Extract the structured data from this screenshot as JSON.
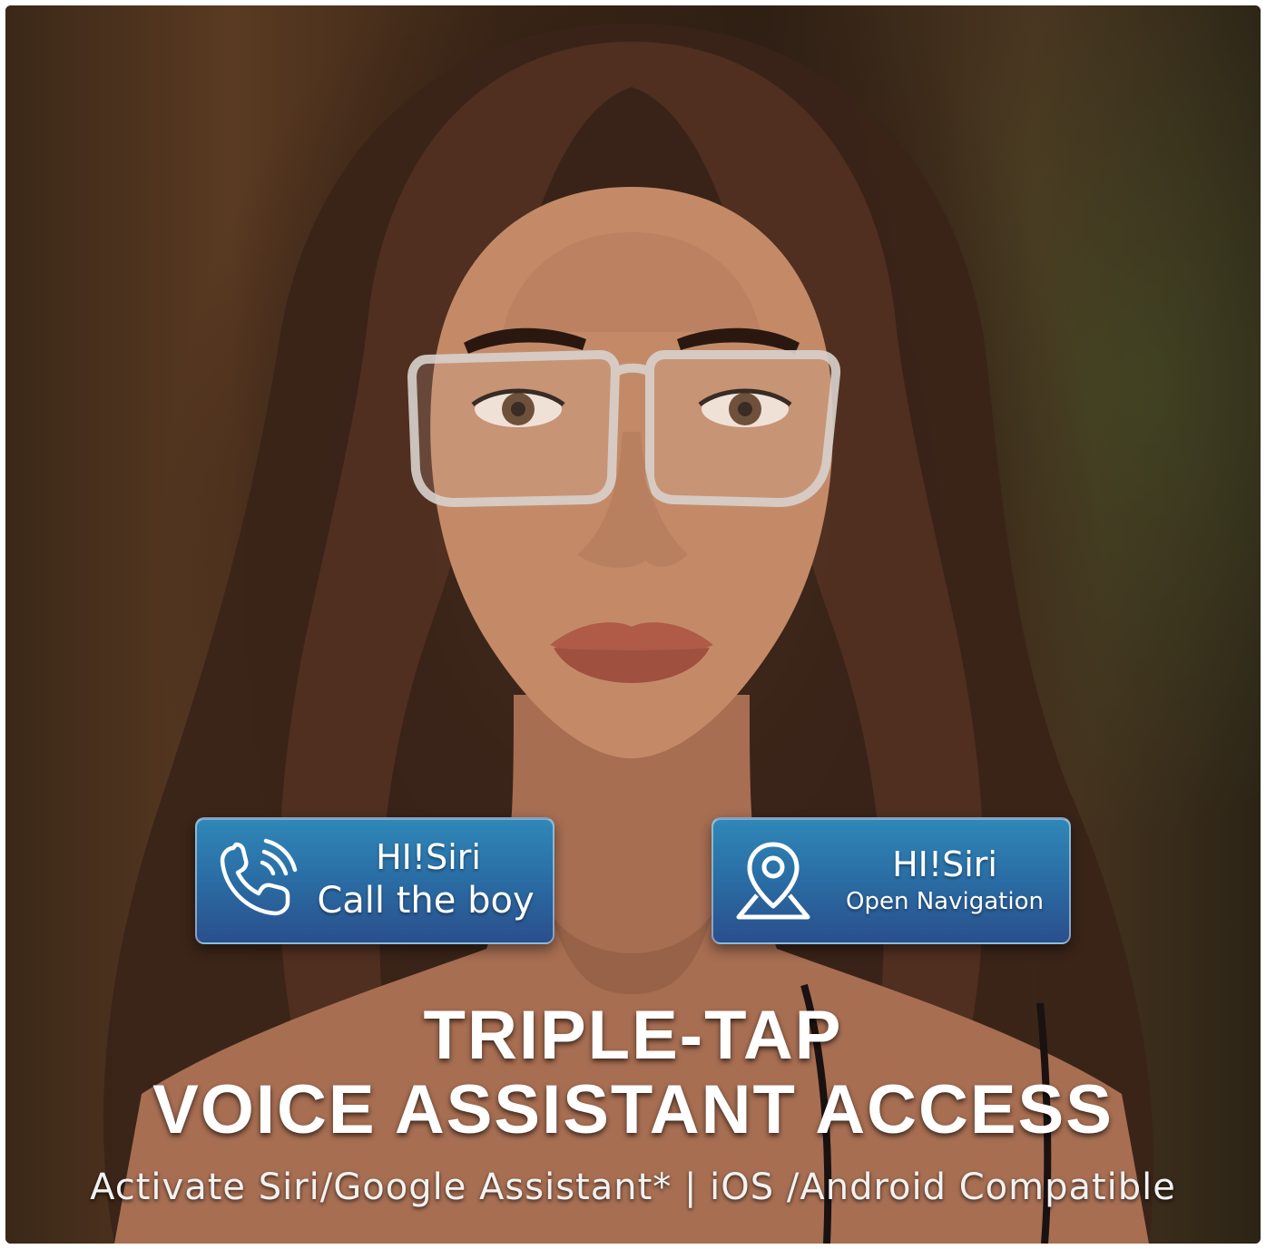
{
  "photo": {
    "subject": "woman-wearing-clear-frame-glasses"
  },
  "callouts": [
    {
      "icon": "phone-call-icon",
      "line1": "HI!Siri",
      "line2": "Call the boy"
    },
    {
      "icon": "map-pin-icon",
      "line1": "HI!Siri",
      "line2": "Open Navigation"
    }
  ],
  "headline": {
    "line1": "TRIPLE-TAP",
    "line2": "VOICE ASSISTANT ACCESS"
  },
  "subline": "Activate Siri/Google Assistant* | iOS /Android Compatible",
  "colors": {
    "callout_top": "#2f87b8",
    "callout_bottom": "#2a4f8c",
    "text": "#ffffff"
  }
}
